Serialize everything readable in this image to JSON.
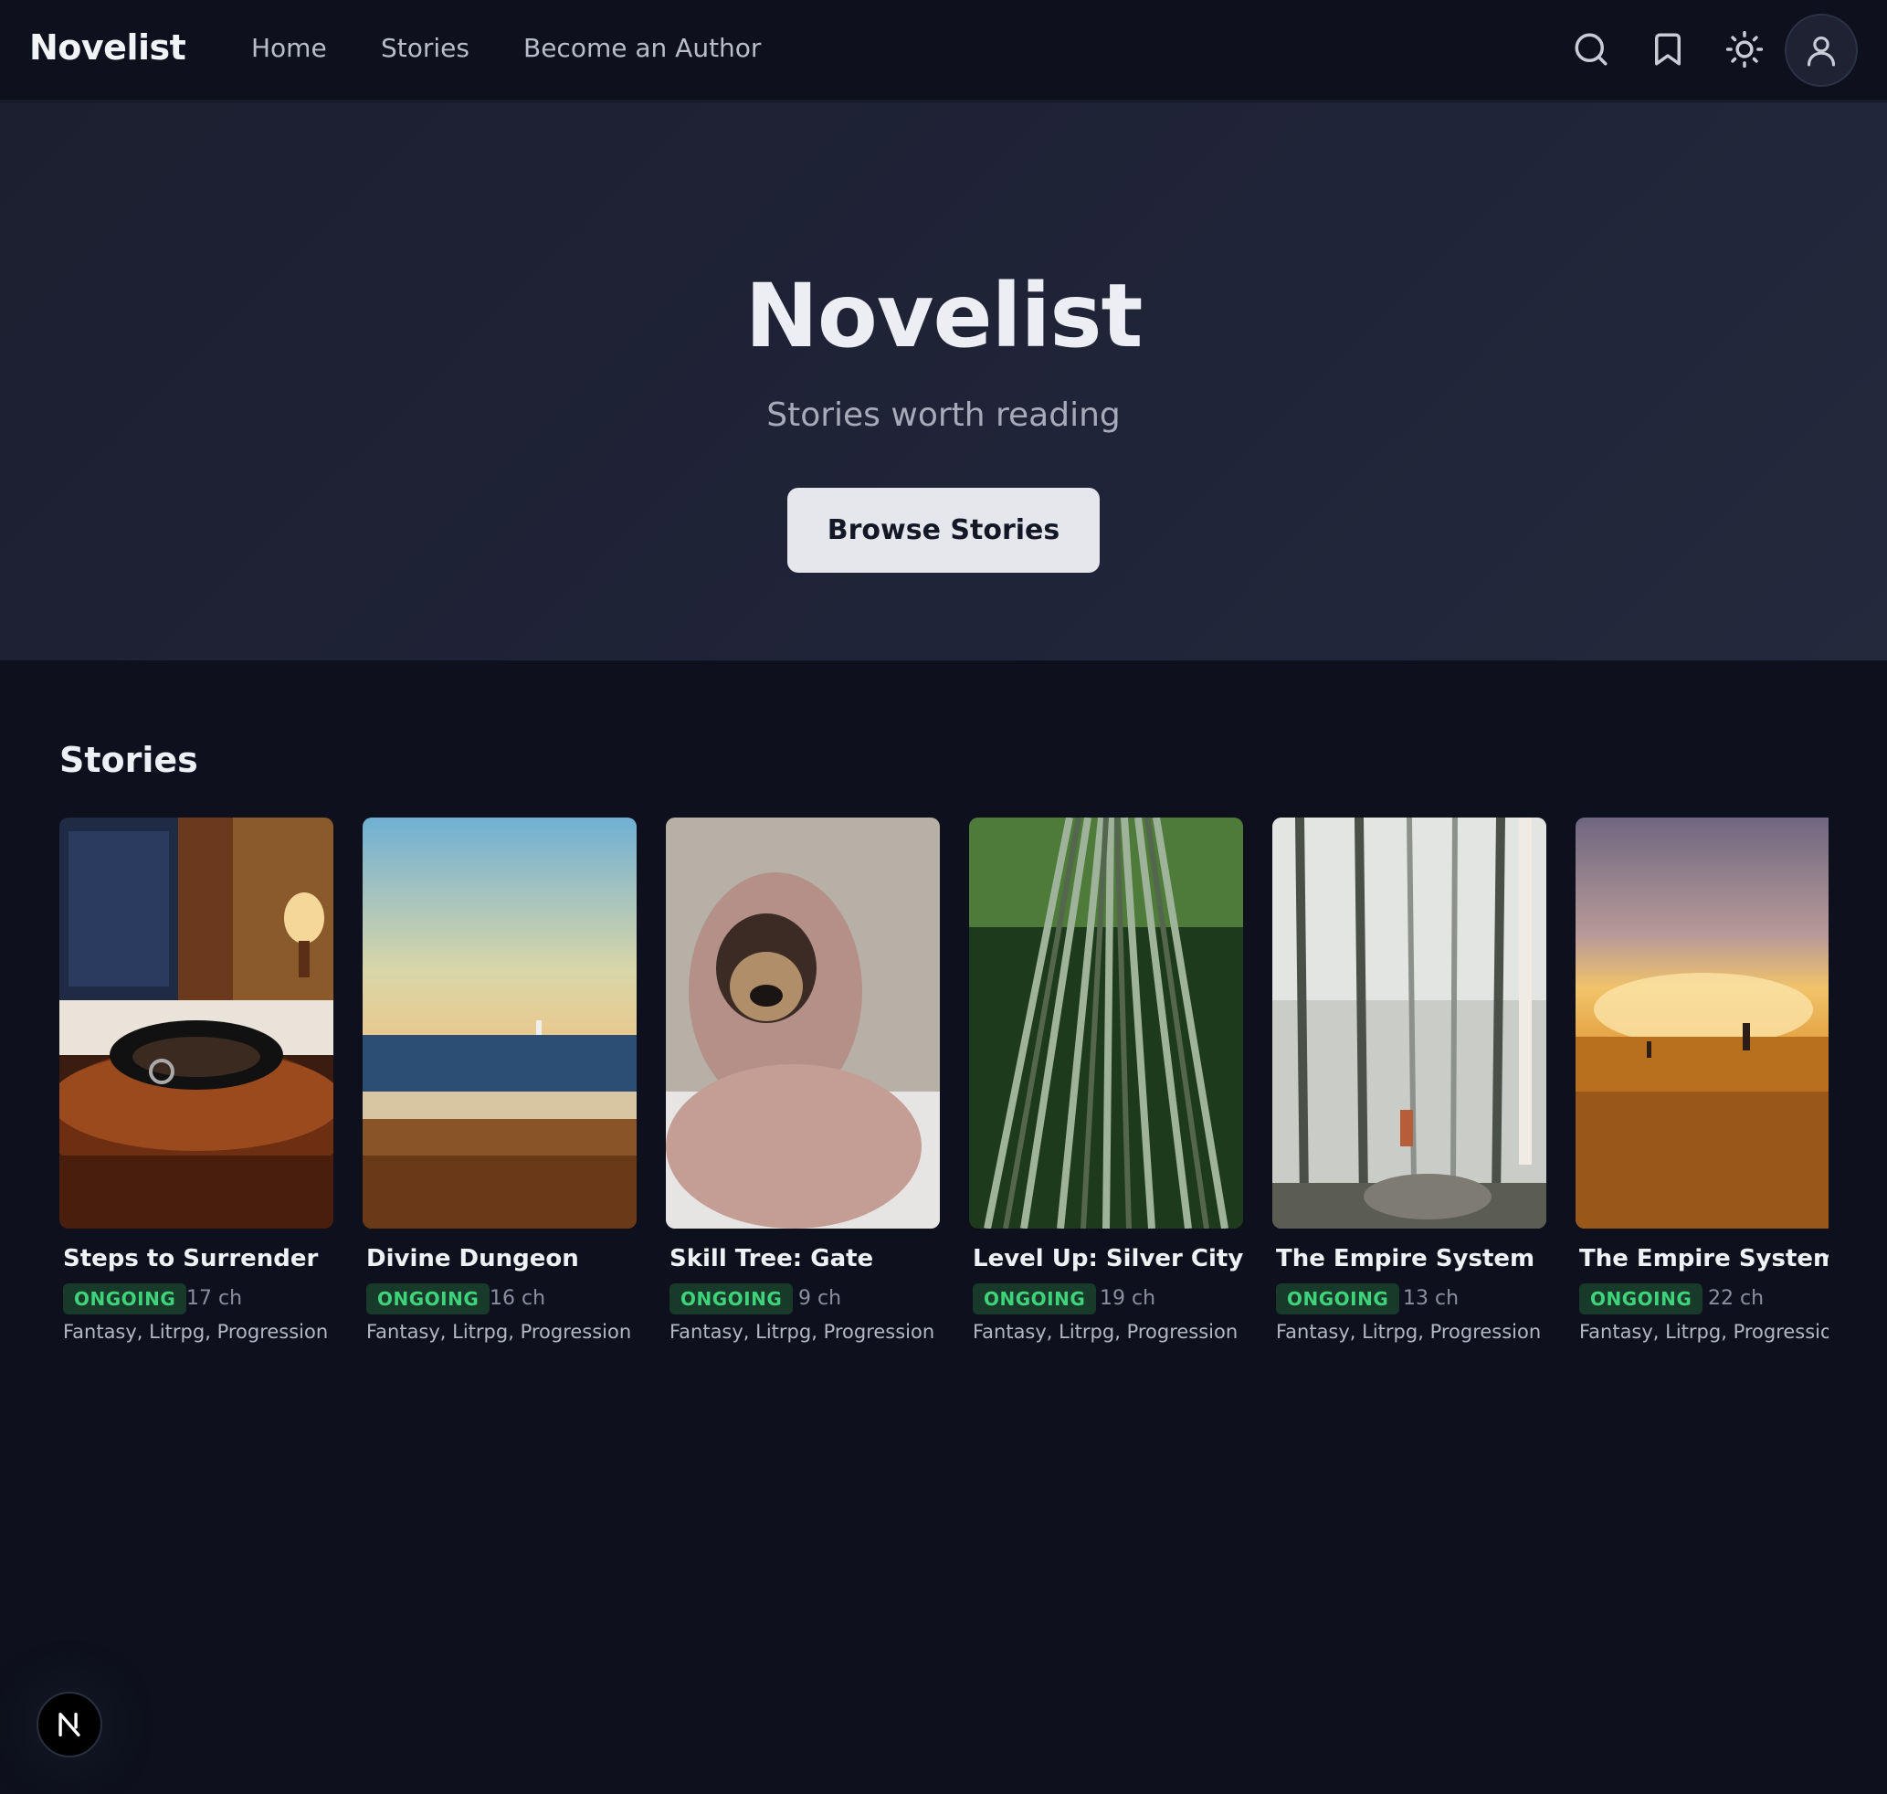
{
  "nav": {
    "brand": "Novelist",
    "links": [
      "Home",
      "Stories",
      "Become an Author"
    ],
    "icons": [
      "search-icon",
      "bookmark-icon",
      "sun-icon",
      "user-icon"
    ]
  },
  "hero": {
    "title": "Novelist",
    "subtitle": "Stories worth reading",
    "cta": "Browse Stories"
  },
  "stories": {
    "heading": "Stories",
    "items": [
      {
        "title": "Steps to Surrender",
        "status": "ONGOING",
        "chapters": "17 ch",
        "genres": "Fantasy, Litrpg, Progression"
      },
      {
        "title": "Divine Dungeon",
        "status": "ONGOING",
        "chapters": "16 ch",
        "genres": "Fantasy, Litrpg, Progression"
      },
      {
        "title": "Skill Tree: Gate",
        "status": "ONGOING",
        "chapters": "9 ch",
        "genres": "Fantasy, Litrpg, Progression"
      },
      {
        "title": "Level Up: Silver City",
        "status": "ONGOING",
        "chapters": "19 ch",
        "genres": "Fantasy, Litrpg, Progression"
      },
      {
        "title": "The Empire System",
        "status": "ONGOING",
        "chapters": "13 ch",
        "genres": "Fantasy, Litrpg, Progression"
      },
      {
        "title": "The Empire System",
        "status": "ONGOING",
        "chapters": "22 ch",
        "genres": "Fantasy, Litrpg, Progression"
      }
    ]
  },
  "fab": {
    "letter": "N"
  },
  "colors": {
    "background": "#0e111d",
    "hero": "#202438",
    "badge_bg": "#173a2a",
    "badge_text": "#3fd37a",
    "button_bg": "#e6e7ec"
  }
}
